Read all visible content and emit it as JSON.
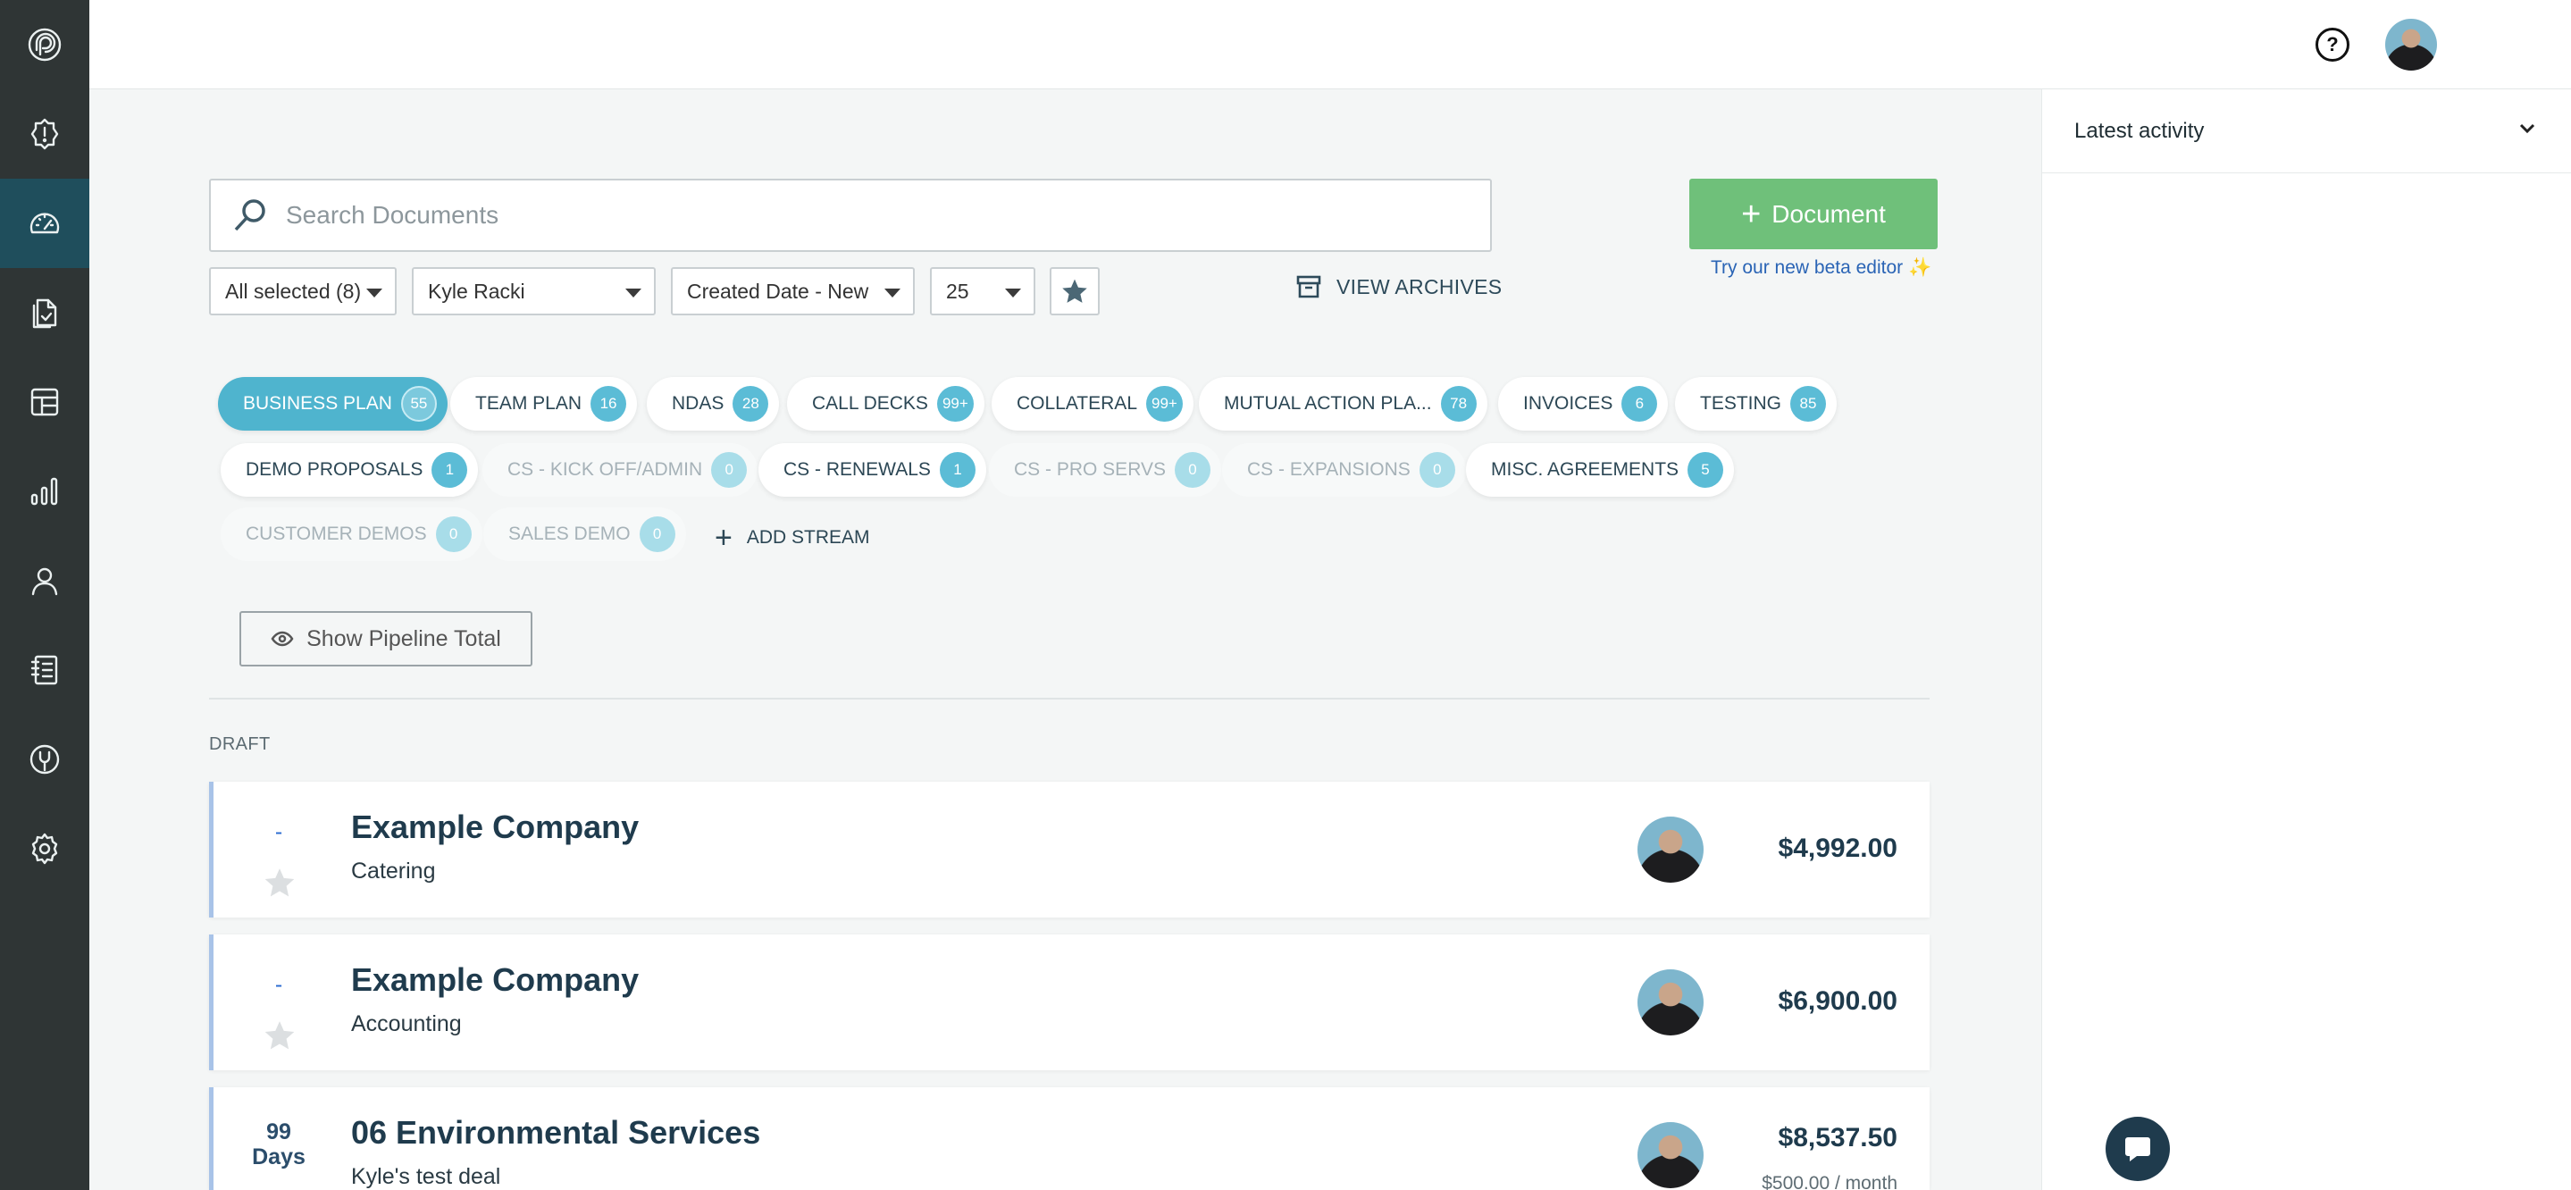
{
  "sidebar": {
    "items": [
      {
        "icon": "logo-icon",
        "name": "sidebar-logo"
      },
      {
        "icon": "alert-gear-icon",
        "name": "sidebar-item-alerts"
      },
      {
        "icon": "dashboard-gauge-icon",
        "name": "sidebar-item-dashboard",
        "active": true
      },
      {
        "icon": "documents-icon",
        "name": "sidebar-item-documents"
      },
      {
        "icon": "templates-icon",
        "name": "sidebar-item-templates"
      },
      {
        "icon": "reports-chart-icon",
        "name": "sidebar-item-reports"
      },
      {
        "icon": "contacts-user-icon",
        "name": "sidebar-item-contacts"
      },
      {
        "icon": "library-notebook-icon",
        "name": "sidebar-item-library"
      },
      {
        "icon": "integrations-icon",
        "name": "sidebar-item-integrations"
      },
      {
        "icon": "settings-gear-icon",
        "name": "sidebar-item-settings"
      }
    ]
  },
  "topbar": {
    "help_label": "?"
  },
  "right_panel": {
    "title": "Latest activity"
  },
  "search": {
    "placeholder": "Search Documents"
  },
  "actions": {
    "new_document_label": "Document",
    "beta_link": "Try our new beta editor ✨"
  },
  "filters": {
    "status": "All selected (8)",
    "owner": "Kyle Racki",
    "sort": "Created Date - New",
    "per_page": "25",
    "view_archives": "VIEW ARCHIVES"
  },
  "streams": [
    {
      "label": "BUSINESS PLAN",
      "count": "55",
      "active": true
    },
    {
      "label": "TEAM PLAN",
      "count": "16"
    },
    {
      "label": "NDAS",
      "count": "28"
    },
    {
      "label": "CALL DECKS",
      "count": "99+"
    },
    {
      "label": "COLLATERAL",
      "count": "99+"
    },
    {
      "label": "MUTUAL ACTION PLA...",
      "count": "78"
    },
    {
      "label": "INVOICES",
      "count": "6"
    },
    {
      "label": "TESTING",
      "count": "85"
    },
    {
      "label": "DEMO PROPOSALS",
      "count": "1"
    },
    {
      "label": "CS - KICK OFF/ADMIN",
      "count": "0",
      "dim": true
    },
    {
      "label": "CS - RENEWALS",
      "count": "1"
    },
    {
      "label": "CS - PRO SERVS",
      "count": "0",
      "dim": true
    },
    {
      "label": "CS - EXPANSIONS",
      "count": "0",
      "dim": true
    },
    {
      "label": "MISC. AGREEMENTS",
      "count": "5"
    },
    {
      "label": "CUSTOMER DEMOS",
      "count": "0",
      "dim": true
    },
    {
      "label": "SALES DEMO",
      "count": "0",
      "dim": true
    }
  ],
  "add_stream_label": "ADD STREAM",
  "pipeline": {
    "label": "Show Pipeline Total"
  },
  "section": {
    "label": "DRAFT"
  },
  "documents": [
    {
      "days": "-",
      "title": "Example Company",
      "subtitle": "Catering",
      "amount": "$4,992.00",
      "recurring": ""
    },
    {
      "days": "-",
      "title": "Example Company",
      "subtitle": "Accounting",
      "amount": "$6,900.00",
      "recurring": ""
    },
    {
      "days": "99\nDays",
      "title": "06 Environmental Services",
      "subtitle": "Kyle's test deal",
      "amount": "$8,537.50",
      "recurring": "$500.00 / month"
    }
  ],
  "colors": {
    "sidebar_bg": "#2f3535",
    "sidebar_active": "#1f4e5c",
    "accent_teal": "#4fb4ce",
    "primary_green": "#6fc07a",
    "link_blue": "#2a64b5"
  }
}
